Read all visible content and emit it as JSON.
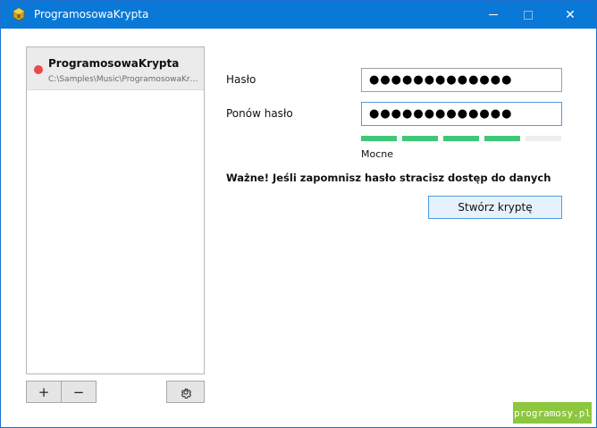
{
  "window": {
    "title": "ProgramosowaKrypta",
    "icon": "app-cube-icon",
    "controls": {
      "minimize": "minimize-icon",
      "maximize": "maximize-icon",
      "close": "close-icon",
      "close_glyph": "✕"
    }
  },
  "sidebar": {
    "items": [
      {
        "name": "ProgramosowaKrypta",
        "path": "C:\\Samples\\Music\\ProgramosowaKrypta",
        "status_color": "#e84b4b",
        "status_icon": "locked-status-dot"
      }
    ],
    "buttons": {
      "add": "+",
      "remove": "−",
      "settings_icon": "gear-icon"
    }
  },
  "form": {
    "password_label": "Hasło",
    "password_value": "●●●●●●●●●●●●●",
    "repeat_label": "Ponów hasło",
    "repeat_value": "●●●●●●●●●●●●●",
    "strength": {
      "filled_segments": 4,
      "total_segments": 5,
      "color": "#3fc77a",
      "label": "Mocne"
    },
    "warning": "Ważne! Jeśli zapomnisz hasło stracisz dostęp do danych",
    "create_button": "Stwórz kryptę"
  },
  "watermark": {
    "text": "programosy.pl",
    "color": "#8dc63f"
  }
}
